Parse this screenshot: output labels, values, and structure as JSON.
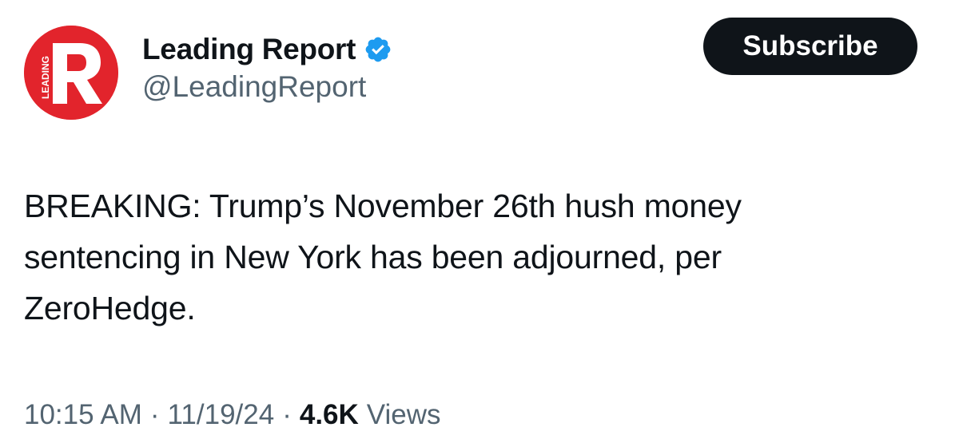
{
  "author": {
    "display_name": "Leading Report",
    "handle": "@LeadingReport",
    "avatar_icon": "leading-report-logo",
    "avatar_letter": "R",
    "avatar_side_text": "LEADING",
    "verified_icon": "verified-badge-icon",
    "brand_color": "#e2242c",
    "verified_color": "#1d9bf0"
  },
  "actions": {
    "subscribe_label": "Subscribe"
  },
  "tweet": {
    "lines": [
      "BREAKING: Trump’s November 26th hush money",
      "sentencing in New York has been adjourned, per",
      "ZeroHedge."
    ]
  },
  "meta": {
    "time": "10:15 AM",
    "separator": "·",
    "date": "11/19/24",
    "views_count": "4.6K",
    "views_label": "Views"
  }
}
